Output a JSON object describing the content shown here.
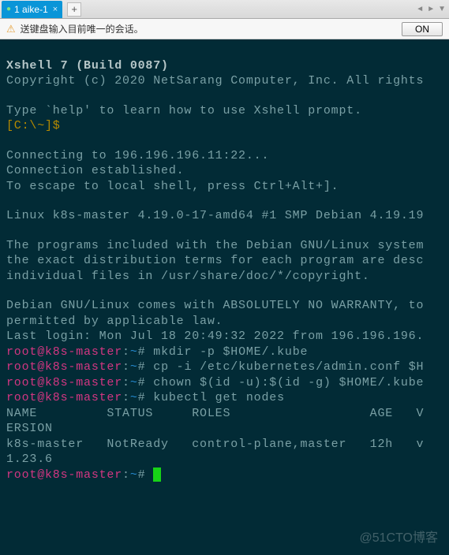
{
  "tabs": {
    "active": {
      "label": "1 aike-1"
    },
    "add_label": "+"
  },
  "info_bar": {
    "message": "送键盘输入目前唯一的会话。",
    "button": "ON"
  },
  "terminal": {
    "title": "Xshell 7 (Build 0087)",
    "copyright": "Copyright (c) 2020 NetSarang Computer, Inc. All rights",
    "help_line": "Type `help' to learn how to use Xshell prompt.",
    "local_prompt": "[C:\\~]$",
    "connecting": "Connecting to 196.196.196.11:22...",
    "established": "Connection established.",
    "escape": "To escape to local shell, press Ctrl+Alt+].",
    "uname": "Linux k8s-master 4.19.0-17-amd64 #1 SMP Debian 4.19.19",
    "debian1": "The programs included with the Debian GNU/Linux system",
    "debian2": "the exact distribution terms for each program are desc",
    "debian3": "individual files in /usr/share/doc/*/copyright.",
    "warranty1": "Debian GNU/Linux comes with ABSOLUTELY NO WARRANTY, to",
    "warranty2": "permitted by applicable law.",
    "lastlogin": "Last login: Mon Jul 18 20:49:32 2022 from 196.196.196.",
    "prompts": {
      "root": "root@k8s-master",
      "sep": ":",
      "path": "~",
      "sym": "# "
    },
    "cmds": {
      "c1": "mkdir -p $HOME/.kube",
      "c2": "cp -i /etc/kubernetes/admin.conf $H",
      "c3": "chown $(id -u):$(id -g) $HOME/.kube",
      "c4": "kubectl get nodes"
    },
    "table": {
      "hdr": "NAME         STATUS     ROLES                  AGE   V",
      "hdr2": "ERSION",
      "row": "k8s-master   NotReady   control-plane,master   12h   v",
      "row2": "1.23.6"
    }
  },
  "watermark": "@51CTO博客"
}
